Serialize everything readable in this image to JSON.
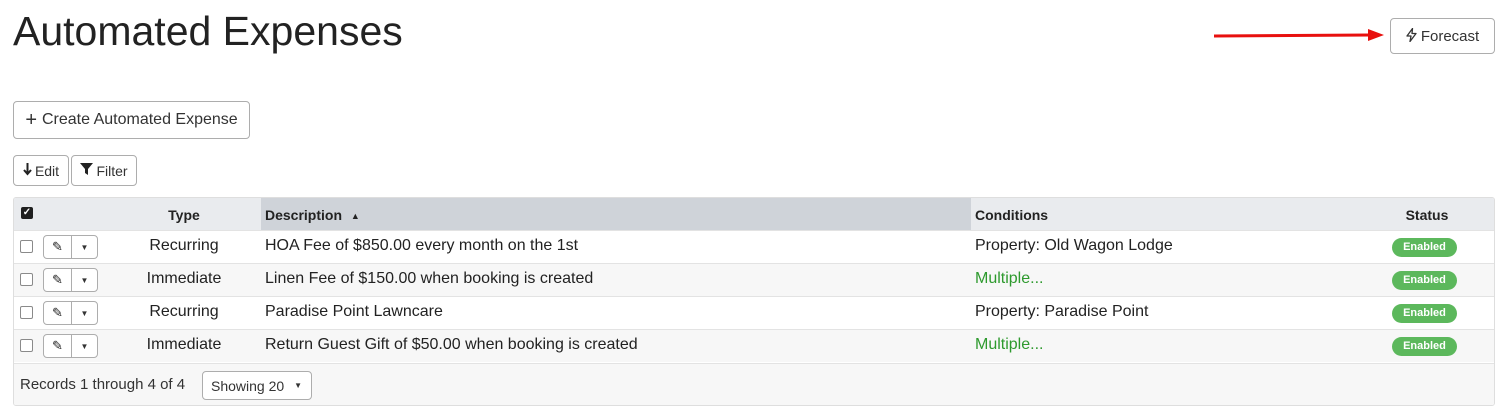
{
  "page": {
    "title": "Automated Expenses"
  },
  "toolbar": {
    "forecast_label": "Forecast",
    "forecast_icon": "bolt-icon",
    "create_label": "Create Automated Expense",
    "create_icon": "plus-icon",
    "edit_label": "Edit",
    "edit_icon": "pencil-down-icon",
    "filter_label": "Filter",
    "filter_icon": "funnel-icon"
  },
  "annotation": {
    "arrow_color": "#e8100e"
  },
  "table": {
    "headers": {
      "type": "Type",
      "description": "Description",
      "conditions": "Conditions",
      "status": "Status"
    },
    "sort": {
      "column": "description",
      "direction": "ascending"
    },
    "rows": [
      {
        "type": "Recurring",
        "description": "HOA Fee of $850.00 every month on the 1st",
        "conditions": "Property: Old Wagon Lodge",
        "conditions_link": false,
        "status": "Enabled"
      },
      {
        "type": "Immediate",
        "description": "Linen Fee of $150.00 when booking is created",
        "conditions": "Multiple...",
        "conditions_link": true,
        "status": "Enabled"
      },
      {
        "type": "Recurring",
        "description": "Paradise Point Lawncare",
        "conditions": "Property: Paradise Point",
        "conditions_link": false,
        "status": "Enabled"
      },
      {
        "type": "Immediate",
        "description": "Return Guest Gift of $50.00 when booking is created",
        "conditions": "Multiple...",
        "conditions_link": true,
        "status": "Enabled"
      }
    ],
    "footer": {
      "records_text": "Records 1 through 4 of 4",
      "page_size_label": "Showing 20"
    }
  },
  "colors": {
    "status_enabled": "#5cb85c",
    "link_green": "#2e9a2e",
    "sorted_header_bg": "#cfd3d9"
  }
}
